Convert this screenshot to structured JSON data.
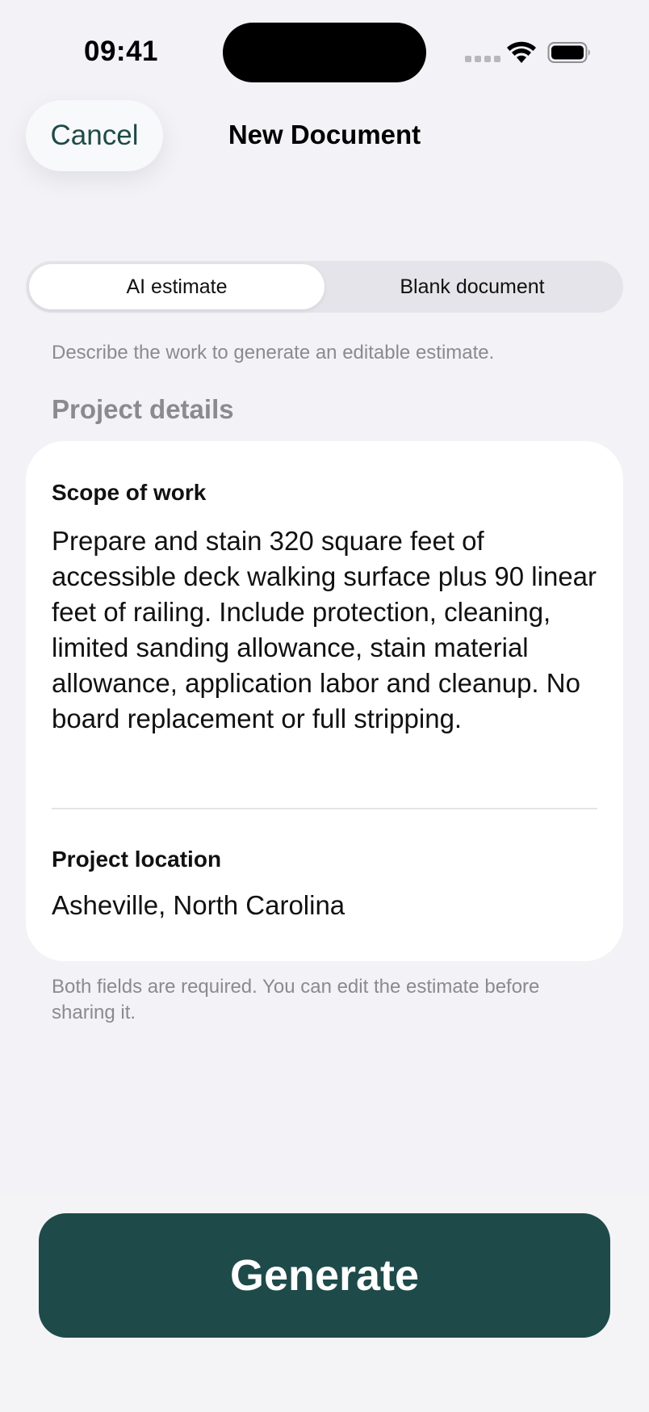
{
  "status_bar": {
    "time": "09:41",
    "icons": [
      "cellular-signal-icon",
      "wifi-icon",
      "battery-icon"
    ]
  },
  "nav": {
    "cancel_label": "Cancel",
    "title": "New Document"
  },
  "mode_toggle": {
    "options": [
      "AI estimate",
      "Blank document"
    ],
    "selected": "AI estimate"
  },
  "hint": "Describe the work to generate an editable estimate.",
  "section_title": "Project details",
  "form": {
    "scope": {
      "label": "Scope of work",
      "value": "Prepare and stain 320 square feet of accessible deck walking surface plus 90 linear feet of railing. Include protection, cleaning, limited sanding allowance, stain material allowance, application labor and cleanup. No board replacement or full stripping."
    },
    "location": {
      "label": "Project location",
      "value": "Asheville, North Carolina"
    }
  },
  "footnote": "Both fields are required. You can edit the estimate before sharing it.",
  "generate_label": "Generate",
  "colors": {
    "accent": "#1e4a49",
    "background": "#f2f2f7",
    "secondary_text": "#8a8a90"
  }
}
